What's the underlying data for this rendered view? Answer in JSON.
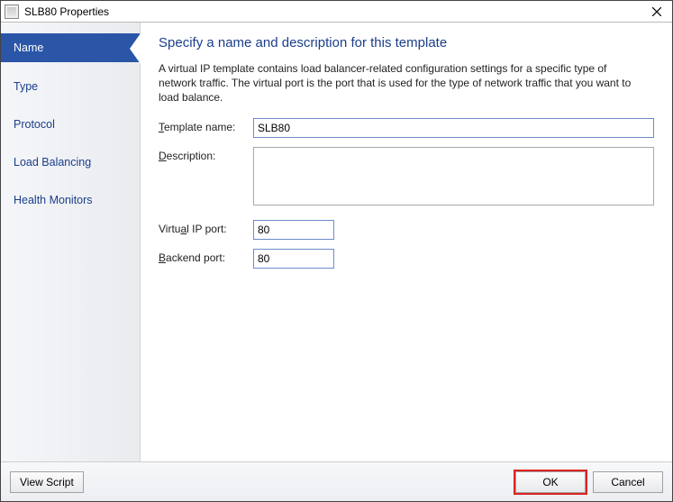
{
  "window": {
    "title": "SLB80 Properties"
  },
  "sidebar": {
    "items": [
      {
        "label": "Name",
        "selected": true
      },
      {
        "label": "Type"
      },
      {
        "label": "Protocol"
      },
      {
        "label": "Load Balancing"
      },
      {
        "label": "Health Monitors"
      }
    ]
  },
  "main": {
    "heading": "Specify a name and description for this template",
    "intro": "A virtual IP template contains load balancer-related configuration settings for a specific type of network traffic. The virtual port is the port that is used for the type of network traffic that you want to load balance.",
    "labels": {
      "template_name_u": "T",
      "template_name_rest": "emplate name:",
      "description_u": "D",
      "description_rest": "escription:",
      "virtual_port_pre": "Virtu",
      "virtual_port_u": "a",
      "virtual_port_post": "l IP port:",
      "backend_u": "B",
      "backend_rest": "ackend port:"
    },
    "values": {
      "template_name": "SLB80",
      "description": "",
      "virtual_ip_port": "80",
      "backend_port": "80"
    }
  },
  "footer": {
    "view_script": "View Script",
    "ok": "OK",
    "cancel": "Cancel"
  }
}
